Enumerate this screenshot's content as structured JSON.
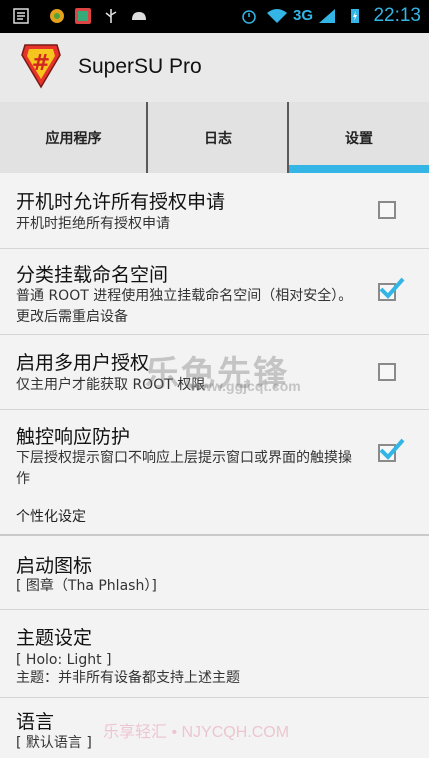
{
  "statusbar": {
    "network_label": "3G",
    "time": "22:13",
    "icons": [
      "notification-icon",
      "app-icon",
      "app-icon",
      "usb-icon",
      "android-icon",
      "alarm-icon",
      "wifi-icon",
      "signal-icon",
      "battery-charging-icon"
    ]
  },
  "app": {
    "title": "SuperSU Pro",
    "accent_color": "#33b5e5"
  },
  "tabs": [
    {
      "label": "应用程序",
      "selected": false
    },
    {
      "label": "日志",
      "selected": false
    },
    {
      "label": "设置",
      "selected": true
    }
  ],
  "settings": [
    {
      "title": "开机时允许所有授权申请",
      "summary": "开机时拒绝所有授权申请",
      "checked": false
    },
    {
      "title": "分类挂载命名空间",
      "summary": "普通 ROOT 进程使用独立挂载命名空间（相对安全）。更改后需重启设备",
      "checked": true
    },
    {
      "title": "启用多用户授权",
      "summary": "仅主用户才能获取 ROOT 权限",
      "checked": false
    },
    {
      "title": "触控响应防护",
      "summary": "下层授权提示窗口不响应上层提示窗口或界面的触摸操作",
      "checked": true
    }
  ],
  "section_personalization": "个性化设定",
  "personalization": [
    {
      "title": "启动图标",
      "summary": "[ 图章（Tha Phlash）]"
    },
    {
      "title": "主题设定",
      "summary": "[ Holo: Light ]",
      "summary2": "主题：并非所有设备都支持上述主题"
    },
    {
      "title": "语言",
      "summary": "[ 默认语言 ]"
    }
  ],
  "watermarks": {
    "center": "乐色先锋",
    "center_small": "www.ggjcqt.com",
    "bottom": "乐享轻汇 • NJYCQH.COM"
  }
}
